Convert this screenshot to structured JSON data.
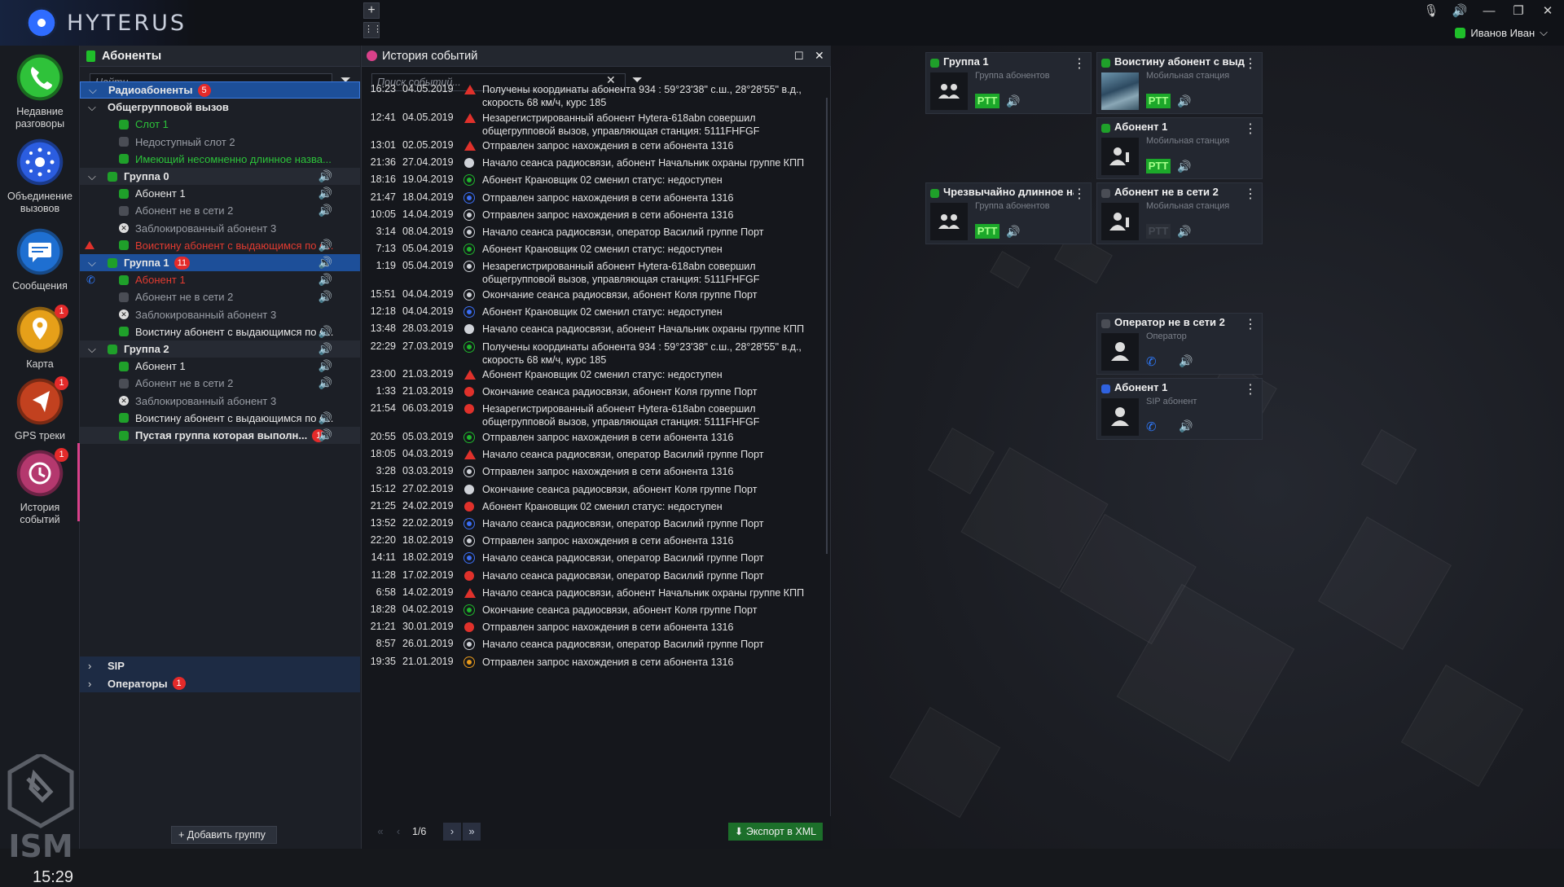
{
  "app": {
    "logo_text": "HYTERUS",
    "user_name": "Иванов Иван",
    "clock": "15:29",
    "brand_text": "ISM"
  },
  "nav": [
    {
      "label": "Недавние разговоры",
      "icon": "phone-icon",
      "badge": ""
    },
    {
      "label": "Объединение вызовов",
      "icon": "merge-calls-icon",
      "badge": ""
    },
    {
      "label": "Сообщения",
      "icon": "message-icon",
      "badge": ""
    },
    {
      "label": "Карта",
      "icon": "map-pin-icon",
      "badge": "1"
    },
    {
      "label": "GPS треки",
      "icon": "gps-track-icon",
      "badge": "1"
    },
    {
      "label": "История событий",
      "icon": "history-icon",
      "badge": "1"
    }
  ],
  "subscribers": {
    "title": "Абоненты",
    "search_placeholder": "Найти...",
    "add_group_label": "Добавить группу",
    "rows": [
      {
        "label": "Радиоабоненты",
        "badge": "5"
      },
      {
        "label": "Общегрупповой вызов",
        "badge": ""
      },
      {
        "label": "Слот 1",
        "badge": ""
      },
      {
        "label": "Недоступный слот 2",
        "badge": ""
      },
      {
        "label": "Имеющий несомненно длинное назва...",
        "badge": ""
      },
      {
        "label": "Группа 0",
        "badge": ""
      },
      {
        "label": "Абонент 1",
        "badge": ""
      },
      {
        "label": "Абонент не в сети 2",
        "badge": ""
      },
      {
        "label": "Заблокированный абонент 3",
        "badge": ""
      },
      {
        "label": "Воистину абонент с выдающимся по с...",
        "badge": ""
      },
      {
        "label": "Группа 1",
        "badge": "11"
      },
      {
        "label": "Абонент 1",
        "badge": ""
      },
      {
        "label": "Абонент не в сети 2",
        "badge": ""
      },
      {
        "label": "Заблокированный абонент 3",
        "badge": ""
      },
      {
        "label": "Воистину абонент с выдающимся по с...",
        "badge": ""
      },
      {
        "label": "Группа 2",
        "badge": ""
      },
      {
        "label": "Абонент 1",
        "badge": ""
      },
      {
        "label": "Абонент не в сети 2",
        "badge": ""
      },
      {
        "label": "Заблокированный абонент 3",
        "badge": ""
      },
      {
        "label": "Воистину абонент с выдающимся по с...",
        "badge": ""
      },
      {
        "label": "Пустая группа которая выполн...",
        "badge": "1"
      }
    ],
    "bottom_rows": [
      {
        "label": "SIP",
        "badge": ""
      },
      {
        "label": "Операторы",
        "badge": "1"
      }
    ]
  },
  "history": {
    "title": "История событий",
    "search_placeholder": "Поиск событий...",
    "page_indicator": "1/6",
    "export_label": "Экспорт в XML",
    "events": [
      {
        "time": "16:23",
        "date": "04.05.2019",
        "type": "warn",
        "text": "Получены координаты абонента 934 : 59°23'38\" с.ш., 28°28'55\" в.д., скорость 68 км/ч, курс 185"
      },
      {
        "time": "12:41",
        "date": "04.05.2019",
        "type": "warn",
        "text": "Незарегистрированный абонент Hytera-618abn совершил общегрупповой вызов, управляющая станция: 5111FHFGF"
      },
      {
        "time": "13:01",
        "date": "02.05.2019",
        "type": "warn",
        "text": "Отправлен запрос нахождения в сети абонента 1316"
      },
      {
        "time": "21:36",
        "date": "27.04.2019",
        "type": "info",
        "text": "Начало сеанса радиосвязи, абонент Начальник охраны группе КПП"
      },
      {
        "time": "18:16",
        "date": "19.04.2019",
        "type": "green",
        "text": "Абонент Крановщик 02 сменил статус: недоступен"
      },
      {
        "time": "21:47",
        "date": "18.04.2019",
        "type": "blue",
        "text": "Отправлен запрос нахождения в сети абонента 1316"
      },
      {
        "time": "10:05",
        "date": "14.04.2019",
        "type": "grey",
        "text": "Отправлен запрос нахождения в сети абонента 1316"
      },
      {
        "time": "3:14",
        "date": "08.04.2019",
        "type": "grey",
        "text": "Начало сеанса радиосвязи, оператор Василий группе Порт"
      },
      {
        "time": "7:13",
        "date": "05.04.2019",
        "type": "green",
        "text": "Абонент Крановщик 02 сменил статус: недоступен"
      },
      {
        "time": "1:19",
        "date": "05.04.2019",
        "type": "grey",
        "text": "Незарегистрированный абонент Hytera-618abn совершил общегрупповой вызов, управляющая станция: 5111FHFGF"
      },
      {
        "time": "15:51",
        "date": "04.04.2019",
        "type": "grey",
        "text": "Окончание сеанса радиосвязи, абонент Коля группе Порт"
      },
      {
        "time": "12:18",
        "date": "04.04.2019",
        "type": "blue",
        "text": "Абонент Крановщик 02 сменил статус: недоступен"
      },
      {
        "time": "13:48",
        "date": "28.03.2019",
        "type": "info",
        "text": "Начало сеанса радиосвязи, абонент Начальник охраны группе КПП"
      },
      {
        "time": "22:29",
        "date": "27.03.2019",
        "type": "green",
        "text": "Получены координаты абонента 934 : 59°23'38\" с.ш., 28°28'55\" в.д., скорость 68 км/ч, курс 185"
      },
      {
        "time": "23:00",
        "date": "21.03.2019",
        "type": "warn",
        "text": "Абонент Крановщик 02 сменил статус: недоступен"
      },
      {
        "time": "1:33",
        "date": "21.03.2019",
        "type": "red",
        "text": "Окончание сеанса радиосвязи, абонент Коля группе Порт"
      },
      {
        "time": "21:54",
        "date": "06.03.2019",
        "type": "red",
        "text": "Незарегистрированный абонент Hytera-618abn совершил общегрупповой вызов, управляющая станция: 5111FHFGF"
      },
      {
        "time": "20:55",
        "date": "05.03.2019",
        "type": "green",
        "text": "Отправлен запрос нахождения в сети абонента 1316"
      },
      {
        "time": "18:05",
        "date": "04.03.2019",
        "type": "warn",
        "text": "Начало сеанса радиосвязи, оператор Василий группе Порт"
      },
      {
        "time": "3:28",
        "date": "03.03.2019",
        "type": "grey",
        "text": "Отправлен запрос нахождения в сети абонента 1316"
      },
      {
        "time": "15:12",
        "date": "27.02.2019",
        "type": "info",
        "text": "Окончание сеанса радиосвязи, абонент Коля группе Порт"
      },
      {
        "time": "21:25",
        "date": "24.02.2019",
        "type": "red",
        "text": "Абонент Крановщик 02 сменил статус: недоступен"
      },
      {
        "time": "13:52",
        "date": "22.02.2019",
        "type": "blue",
        "text": "Начало сеанса радиосвязи, оператор Василий группе Порт"
      },
      {
        "time": "22:20",
        "date": "18.02.2019",
        "type": "grey",
        "text": "Отправлен запрос нахождения в сети абонента 1316"
      },
      {
        "time": "14:11",
        "date": "18.02.2019",
        "type": "blue",
        "text": "Начало сеанса радиосвязи, оператор Василий группе Порт"
      },
      {
        "time": "11:28",
        "date": "17.02.2019",
        "type": "red",
        "text": "Начало сеанса радиосвязи, оператор Василий группе Порт"
      },
      {
        "time": "6:58",
        "date": "14.02.2019",
        "type": "warn",
        "text": "Начало сеанса радиосвязи, абонент Начальник охраны группе КПП"
      },
      {
        "time": "18:28",
        "date": "04.02.2019",
        "type": "green",
        "text": "Окончание сеанса радиосвязи, абонент Коля группе Порт"
      },
      {
        "time": "21:21",
        "date": "30.01.2019",
        "type": "red",
        "text": "Отправлен запрос нахождения в сети абонента 1316"
      },
      {
        "time": "8:57",
        "date": "26.01.2019",
        "type": "grey",
        "text": "Начало сеанса радиосвязи, оператор Василий группе Порт"
      },
      {
        "time": "19:35",
        "date": "21.01.2019",
        "type": "orange",
        "text": "Отправлен запрос нахождения в сети абонента 1316"
      }
    ]
  },
  "cards": [
    {
      "title": "Группа 1",
      "subtitle": "Группа абонентов",
      "status": "on",
      "ptt": "PTT",
      "ptt_active": true,
      "kind": "group"
    },
    {
      "title": "Воистину абонент с выда...",
      "subtitle": "Мобильная станция",
      "status": "on",
      "ptt": "PTT",
      "ptt_active": true,
      "kind": "photo"
    },
    {
      "title": "Абонент 1",
      "subtitle": "Мобильная станция",
      "status": "on",
      "ptt": "PTT",
      "ptt_active": true,
      "kind": "radio"
    },
    {
      "title": "Чрезвычайно длинное на...",
      "subtitle": "Группа абонентов",
      "status": "on",
      "ptt": "PTT",
      "ptt_active": true,
      "kind": "group"
    },
    {
      "title": "Абонент не в сети 2",
      "subtitle": "Мобильная станция",
      "status": "off",
      "ptt": "PTT",
      "ptt_active": false,
      "kind": "radio"
    },
    {
      "title": "Оператор не в сети 2",
      "subtitle": "Оператор",
      "status": "off",
      "ptt": "",
      "ptt_active": false,
      "kind": "phone"
    },
    {
      "title": "Абонент 1",
      "subtitle": "SIP абонент",
      "status": "blue",
      "ptt": "",
      "ptt_active": false,
      "kind": "phone"
    }
  ],
  "colors": {
    "accent_green": "#1fa02a",
    "alert_red": "#e42a2a",
    "selection_blue": "#1d4f99",
    "history_accent": "#d9418a"
  }
}
